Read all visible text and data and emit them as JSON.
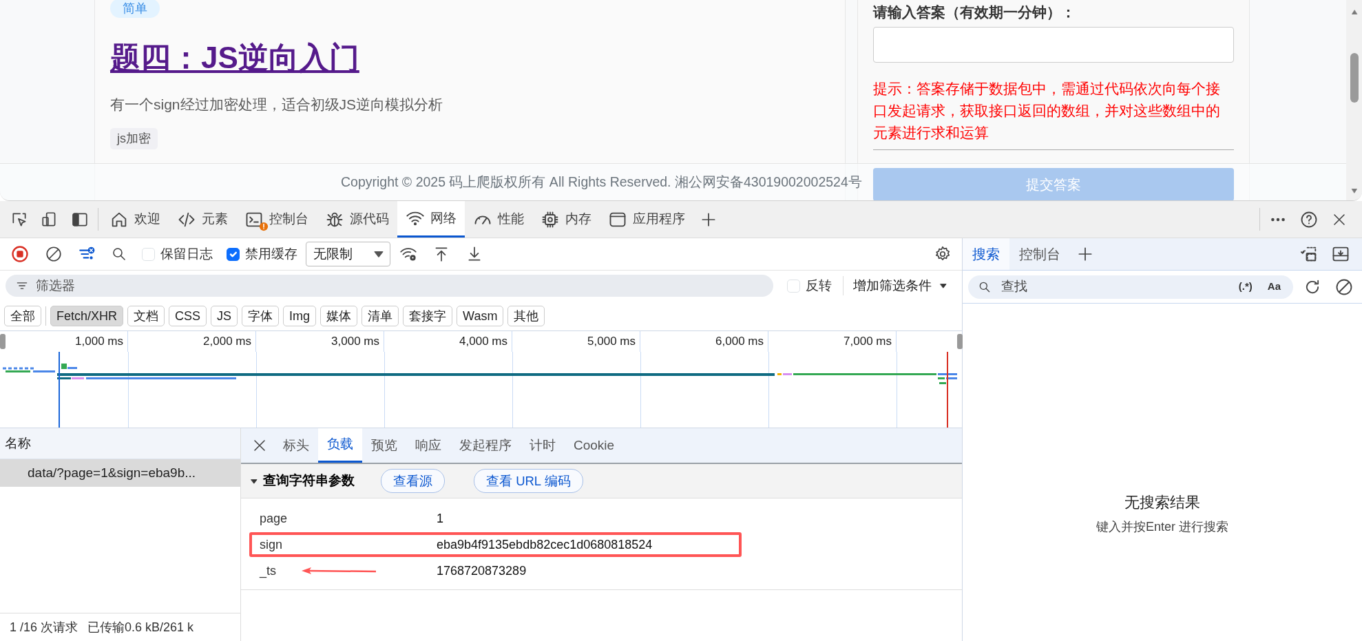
{
  "page": {
    "problem": {
      "difficulty": "简单",
      "title": "题四：JS逆向入门",
      "description": "有一个sign经过加密处理，适合初级JS逆向模拟分析",
      "tags": [
        "js加密"
      ]
    },
    "answer_panel": {
      "label": "请输入答案（有效期一分钟）：",
      "hint": "提示：答案存储于数据包中，需通过代码依次向每个接口发起请求，获取接口返回的数组，并对这些数组中的元素进行求和运算",
      "submit": "提交答案"
    },
    "footer": "Copyright © 2025 码上爬版权所有 All Rights Reserved. 湘公网安备43019002002524号"
  },
  "devtools": {
    "tabs": [
      {
        "label": "欢迎",
        "selected": false,
        "warning": false
      },
      {
        "label": "元素",
        "selected": false,
        "warning": false
      },
      {
        "label": "控制台",
        "selected": false,
        "warning": true
      },
      {
        "label": "源代码",
        "selected": false,
        "warning": false
      },
      {
        "label": "网络",
        "selected": true,
        "warning": false
      },
      {
        "label": "性能",
        "selected": false,
        "warning": false
      },
      {
        "label": "内存",
        "selected": false,
        "warning": false
      },
      {
        "label": "应用程序",
        "selected": false,
        "warning": false
      }
    ],
    "toolbar": {
      "recording": true,
      "preserve_log": {
        "label": "保留日志",
        "checked": false
      },
      "disable_cache": {
        "label": "禁用缓存",
        "checked": true
      },
      "throttling": "无限制"
    },
    "filter": {
      "placeholder": "筛选器",
      "invert": {
        "label": "反转",
        "checked": false
      },
      "more_filters": "增加筛选条件"
    },
    "type_filters": [
      {
        "label": "全部",
        "selected": false
      },
      {
        "label": "Fetch/XHR",
        "selected": true
      },
      {
        "label": "文档",
        "selected": false
      },
      {
        "label": "CSS",
        "selected": false
      },
      {
        "label": "JS",
        "selected": false
      },
      {
        "label": "字体",
        "selected": false
      },
      {
        "label": "Img",
        "selected": false
      },
      {
        "label": "媒体",
        "selected": false
      },
      {
        "label": "清单",
        "selected": false
      },
      {
        "label": "套接字",
        "selected": false
      },
      {
        "label": "Wasm",
        "selected": false
      },
      {
        "label": "其他",
        "selected": false
      }
    ],
    "timeline": {
      "ticks": [
        "1,000 ms",
        "2,000 ms",
        "3,000 ms",
        "4,000 ms",
        "5,000 ms",
        "6,000 ms",
        "7,000 ms"
      ]
    },
    "requests": {
      "column": "名称",
      "rows": [
        {
          "name": "data/?page=1&sign=eba9b...",
          "selected": true
        }
      ]
    },
    "detail_tabs": [
      {
        "label": "标头",
        "selected": false
      },
      {
        "label": "负载",
        "selected": true
      },
      {
        "label": "预览",
        "selected": false
      },
      {
        "label": "响应",
        "selected": false
      },
      {
        "label": "发起程序",
        "selected": false
      },
      {
        "label": "计时",
        "selected": false
      },
      {
        "label": "Cookie",
        "selected": false
      }
    ],
    "payload": {
      "section": "查询字符串参数",
      "expanded": true,
      "buttons": [
        "查看源",
        "查看 URL 编码"
      ],
      "params": [
        {
          "key": "page",
          "value": "1",
          "kind": "plain"
        },
        {
          "key": "sign",
          "value": "eba9b4f9135ebdb82cec1d0680818524",
          "kind": "boxed"
        },
        {
          "key": "_ts",
          "value": "1768720873289",
          "kind": "arrowed"
        }
      ]
    },
    "status": [
      "1 /16 次请求",
      "已传输0.6 kB/261 k"
    ],
    "drawer": {
      "tabs": [
        {
          "label": "搜索",
          "selected": true
        },
        {
          "label": "控制台",
          "selected": false
        }
      ],
      "search": {
        "placeholder": "查找",
        "regex": "(.*)",
        "match_case": "Aa"
      },
      "empty_title": "无搜索结果",
      "empty_hint": "键入并按Enter 进行搜索"
    }
  }
}
